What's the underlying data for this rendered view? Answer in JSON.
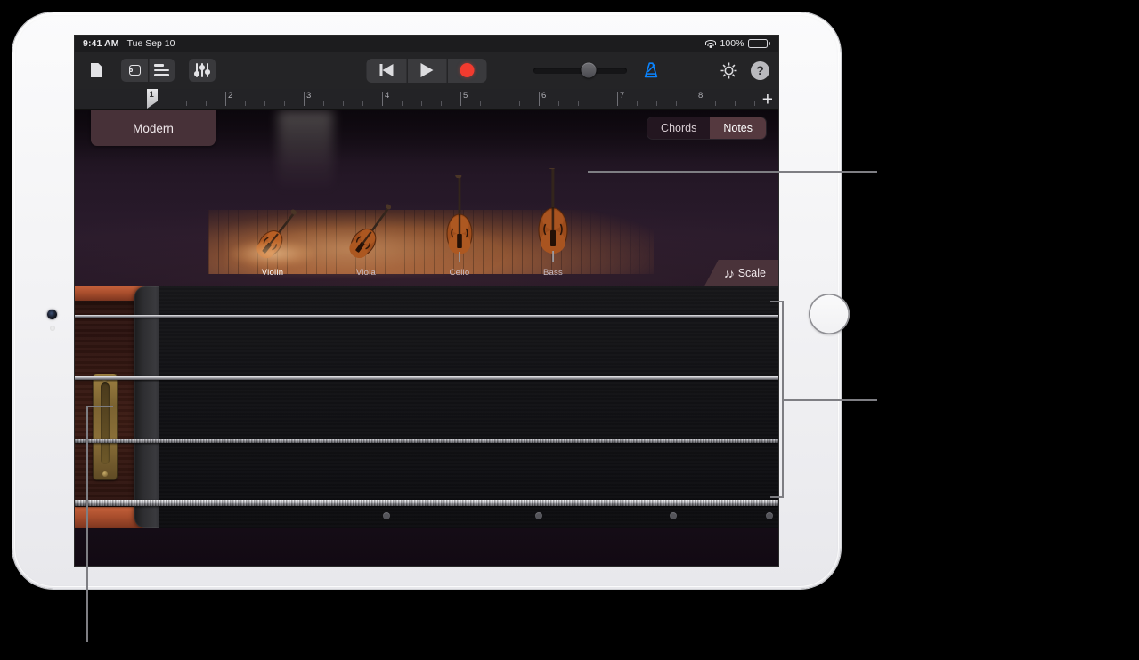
{
  "device": {
    "name": "iPad"
  },
  "status_bar": {
    "time": "9:41 AM",
    "date": "Tue Sep 10",
    "battery_percent": "100%",
    "wifi_icon": "wifi-icon",
    "battery_icon": "battery-full-icon"
  },
  "toolbar": {
    "my_songs_label": "document-icon",
    "browser_icon": "instrument-browser-icon",
    "tracks_icon": "track-view-icon",
    "mixer_icon": "mixer-faders-icon",
    "rewind_icon": "rewind-icon",
    "play_icon": "play-icon",
    "record_icon": "record-icon",
    "master_volume_label": "master-volume-slider",
    "metronome_icon": "metronome-icon",
    "settings_icon": "gear-icon",
    "help_label": "?",
    "accent_color": "#0a84ff",
    "record_color": "#f23b2f"
  },
  "ruler": {
    "bars": [
      "1",
      "2",
      "3",
      "4",
      "5",
      "6",
      "7",
      "8"
    ],
    "playhead_bar": "1",
    "add_label": "+"
  },
  "selector": {
    "preset_name": "Modern",
    "segments": [
      {
        "label": "Chords",
        "selected": false
      },
      {
        "label": "Notes",
        "selected": true
      }
    ],
    "instruments": [
      {
        "label": "Violin",
        "selected": true
      },
      {
        "label": "Viola",
        "selected": false
      },
      {
        "label": "Cello",
        "selected": false
      },
      {
        "label": "Bass",
        "selected": false
      }
    ],
    "scale_button": {
      "label": "Scale",
      "icon": "double-eighth-note-icon"
    }
  },
  "strings_instrument": {
    "name": "smart-strings",
    "string_count": 4,
    "strings": [
      {
        "index": 1,
        "thickness": 3
      },
      {
        "index": 2,
        "thickness": 4
      },
      {
        "index": 3,
        "thickness": 5
      },
      {
        "index": 4,
        "thickness": 7
      }
    ],
    "position_dots": 4
  },
  "callouts": {
    "instrument_selector_leader": "callout-line-instrument-selector",
    "strings_bracket": "callout-bracket-strings",
    "tuning_pegs_leader": "callout-line-tuning-pegs"
  }
}
